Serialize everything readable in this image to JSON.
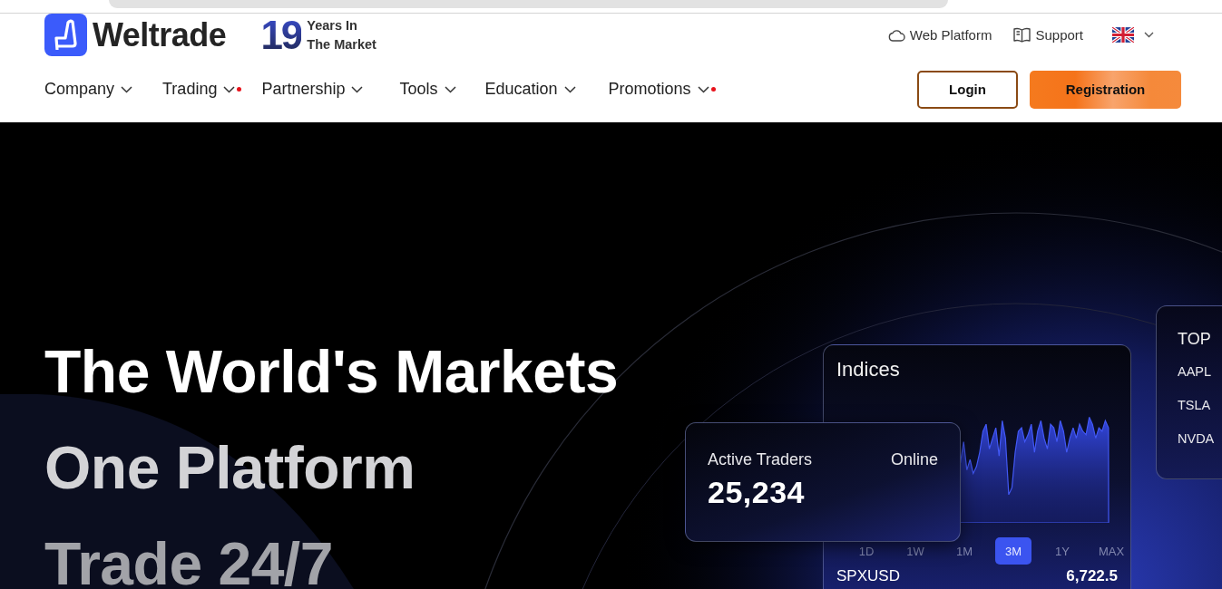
{
  "header": {
    "logo": {
      "name": "Weltrade"
    },
    "years": {
      "number": "19",
      "line1": "Years In",
      "line2": "The Market"
    },
    "top_links": [
      {
        "kind": "cloud",
        "label": "Web Platform"
      },
      {
        "kind": "book",
        "label": "Support"
      }
    ],
    "nav": [
      {
        "label": "Company",
        "dot": false
      },
      {
        "label": "Trading",
        "dot": true
      },
      {
        "label": "Partnership",
        "dot": false
      },
      {
        "label": "Tools",
        "dot": false
      },
      {
        "label": "Education",
        "dot": false
      },
      {
        "label": "Promotions",
        "dot": true
      }
    ],
    "buttons": [
      {
        "kind": "outline",
        "label": "Login"
      },
      {
        "kind": "filled",
        "label": "Registration"
      }
    ]
  },
  "hero": {
    "headline": [
      "The World's Markets",
      "One Platform",
      "Trade 24/7"
    ],
    "traders_card": {
      "label": "Active Traders",
      "status": "Online",
      "value": "25,234"
    },
    "indices_card": {
      "title": "Indices",
      "timeframes": [
        {
          "label": "1D",
          "selected": false
        },
        {
          "label": "1W",
          "selected": false
        },
        {
          "label": "1M",
          "selected": false
        },
        {
          "label": "3M",
          "selected": true
        },
        {
          "label": "1Y",
          "selected": false
        },
        {
          "label": "MAX",
          "selected": false
        }
      ],
      "rows": [
        {
          "symbol": "SPXUSD",
          "price": "6,722.5"
        }
      ]
    },
    "top_card": {
      "title": "TOP",
      "symbols": [
        "AAPL",
        "TSLA",
        "NVDA"
      ]
    }
  }
}
